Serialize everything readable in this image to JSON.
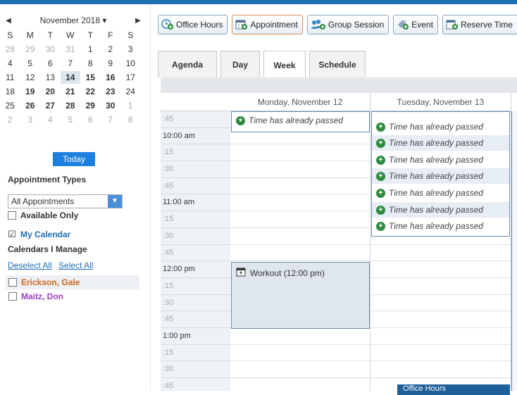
{
  "calendar": {
    "month_label": "November 2018 ▾",
    "prev": "◀",
    "next": "▶",
    "dow": [
      "S",
      "M",
      "T",
      "W",
      "T",
      "F",
      "S"
    ],
    "weeks": [
      [
        "28",
        "29",
        "30",
        "31",
        "1",
        "2",
        "3"
      ],
      [
        "4",
        "5",
        "6",
        "7",
        "8",
        "9",
        "10"
      ],
      [
        "11",
        "12",
        "13",
        "14",
        "15",
        "16",
        "17"
      ],
      [
        "18",
        "19",
        "20",
        "21",
        "22",
        "23",
        "24"
      ],
      [
        "25",
        "26",
        "27",
        "28",
        "29",
        "30",
        "1"
      ],
      [
        "2",
        "3",
        "4",
        "5",
        "6",
        "7",
        "8"
      ]
    ],
    "today_label": "Today"
  },
  "filters": {
    "appointment_types_title": "Appointment Types",
    "select_value": "All Appointments",
    "available_only": "Available Only",
    "my_calendar": "My Calendar",
    "calendars_manage": "Calendars I Manage",
    "deselect_all": "Deselect All",
    "select_all": "Select All",
    "calendars": [
      {
        "name": "Erickson, Gale",
        "color": "#d2691e"
      },
      {
        "name": "Maitz, Don",
        "color": "#9b3fbf"
      }
    ]
  },
  "toolbar": {
    "office_hours": "Office Hours",
    "appointment": "Appointment",
    "group_session": "Group Session",
    "event": "Event",
    "reserve_time": "Reserve Time"
  },
  "tabs": {
    "agenda": "Agenda",
    "day": "Day",
    "week": "Week",
    "schedule": "Schedule"
  },
  "grid": {
    "day1": "Monday, November 12",
    "day2": "Tuesday, November 13",
    "times": [
      ":45",
      "10:00 am",
      ":15",
      ":30",
      ":45",
      "11:00 am",
      ":15",
      ":30",
      ":45",
      "12:00 pm",
      ":15",
      ":30",
      ":45",
      "1:00 pm",
      ":15",
      ":30",
      ":45"
    ],
    "passed_text": "Time has already passed",
    "event_title": "Workout (12:00 pm)",
    "office_popup": "Office Hours"
  },
  "colors": {
    "accent": "#1f6db3",
    "today_button": "#1d7fe0",
    "passed_icon": "#2d8a3c"
  }
}
